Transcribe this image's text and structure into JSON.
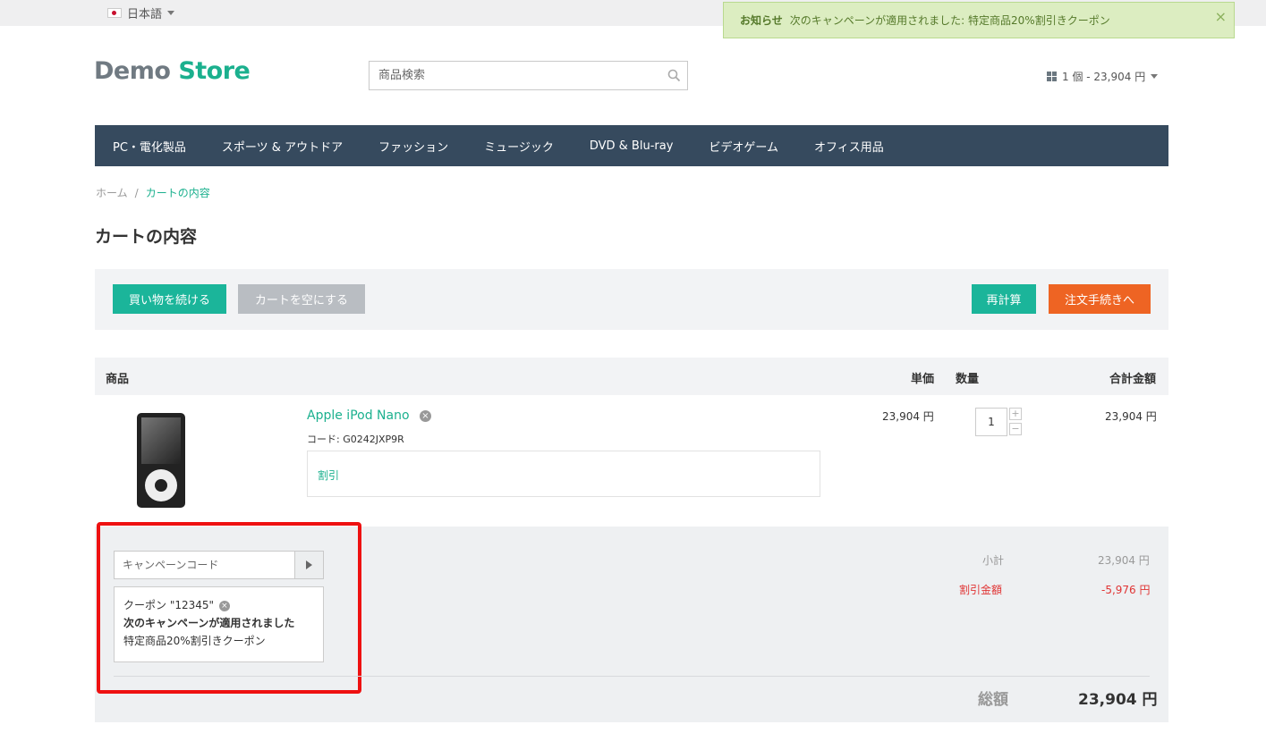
{
  "topbar": {
    "language": "日本語"
  },
  "notice": {
    "title": "お知らせ",
    "message": "次のキャンペーンが適用されました: 特定商品20%割引きクーポン",
    "close": "×"
  },
  "header": {
    "logo_part1": "Demo",
    "logo_part2": "Store",
    "search_placeholder": "商品検索",
    "mini_cart": "1 個 - 23,904 円"
  },
  "nav": {
    "items": [
      "PC・電化製品",
      "スポーツ & アウトドア",
      "ファッション",
      "ミュージック",
      "DVD & Blu-ray",
      "ビデオゲーム",
      "オフィス用品"
    ]
  },
  "breadcrumb": {
    "home": "ホーム",
    "separator": "/",
    "current": "カートの内容"
  },
  "page_title": "カートの内容",
  "actions": {
    "continue": "買い物を続ける",
    "clear": "カートを空にする",
    "recalc": "再計算",
    "checkout": "注文手続きへ"
  },
  "table": {
    "headers": {
      "product": "商品",
      "price": "単価",
      "qty": "数量",
      "total": "合計金額"
    }
  },
  "item": {
    "name": "Apple iPod Nano",
    "remove": "×",
    "code": "コード: G0242JXP9R",
    "discount_label": "割引",
    "price": "23,904 円",
    "qty": "1",
    "qty_plus": "+",
    "qty_minus": "−",
    "total": "23,904 円"
  },
  "campaign": {
    "placeholder": "キャンペーンコード",
    "coupon_line": "クーポン \"12345\"",
    "coupon_remove": "×",
    "applied_title": "次のキャンペーンが適用されました",
    "applied_desc": "特定商品20%割引きクーポン"
  },
  "summary": {
    "subtotal_label": "小計",
    "subtotal_value": "23,904 円",
    "discount_label": "割引金額",
    "discount_value": "-5,976 円",
    "total_label": "総額",
    "total_value": "23,904 円"
  },
  "colors": {
    "brand_green": "#1bb08e",
    "nav_bg": "#364a5e",
    "checkout_orange": "#ee6423",
    "discount_red": "#e03434",
    "highlight_red": "#ee1111"
  }
}
